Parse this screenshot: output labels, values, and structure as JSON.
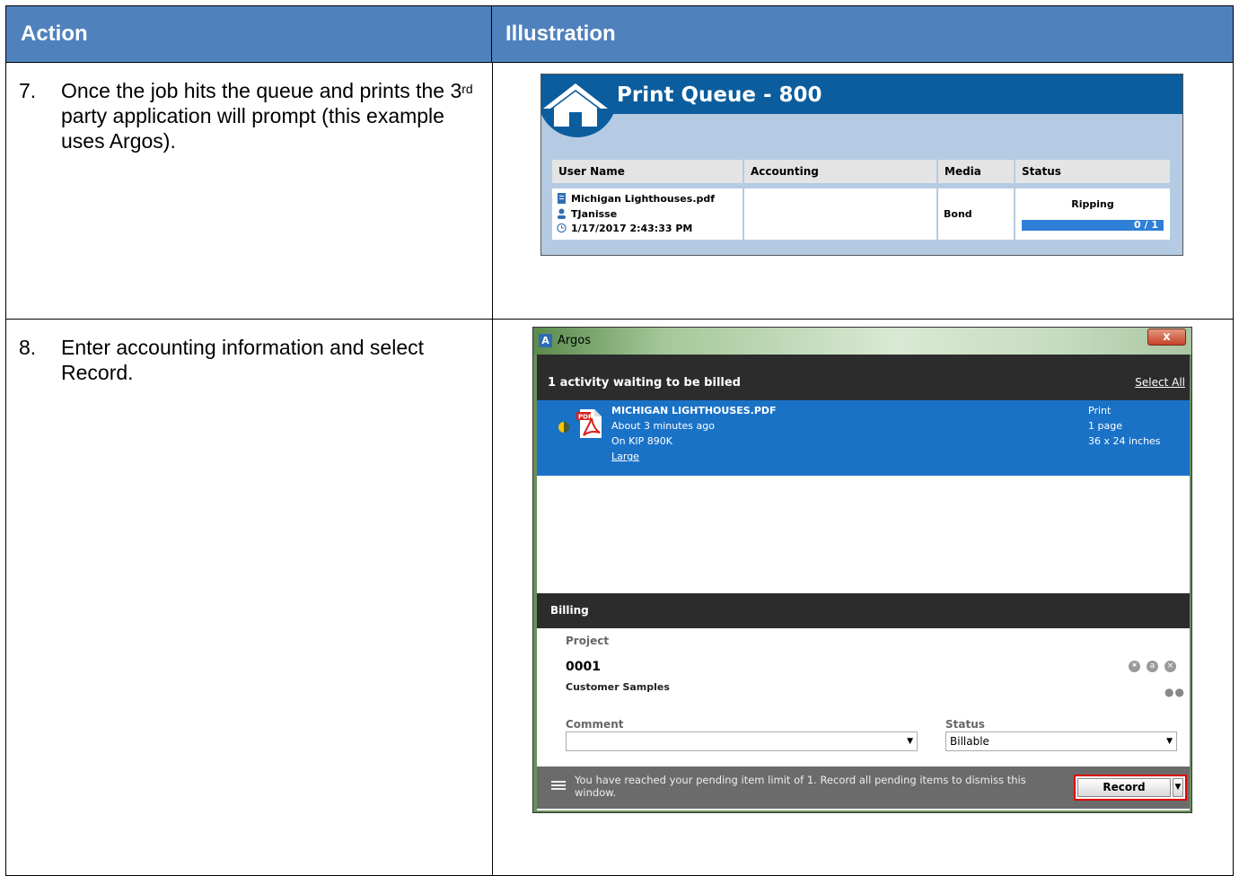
{
  "table": {
    "headers": {
      "action": "Action",
      "illustration": "Illustration"
    },
    "steps": [
      {
        "number": "7.",
        "text_a": "Once the job hits the queue and prints the 3",
        "sup": "rd",
        "text_b": " party application will prompt (this example uses Argos)."
      },
      {
        "number": "8.",
        "text": "Enter accounting information and select Record."
      }
    ]
  },
  "print_queue": {
    "title": "Print Queue - 800",
    "columns": [
      "User Name",
      "Accounting",
      "Media",
      "Status"
    ],
    "row": {
      "file": "Michigan Lighthouses.pdf",
      "user": "TJanisse",
      "time": "1/17/2017 2:43:33 PM",
      "accounting": "",
      "media": "Bond",
      "status": "Ripping",
      "progress_text": "0 / 1"
    }
  },
  "argos": {
    "window_title": "Argos",
    "close_label": "x",
    "activity_header": "1 activity waiting to be billed",
    "select_all": "Select All",
    "item": {
      "name": "MICHIGAN LIGHTHOUSES.PDF",
      "time": "About 3 minutes ago",
      "device": "On KIP 890K",
      "size_link": "Large",
      "type": "Print",
      "pages": "1 page",
      "dimensions": "36 x 24 inches"
    },
    "billing_header": "Billing",
    "project_label": "Project",
    "project_code": "0001",
    "project_desc": "Customer Samples",
    "comment_label": "Comment",
    "comment_value": "",
    "status_label": "Status",
    "status_value": "Billable",
    "footer_msg": "You have reached your pending item limit of 1. Record all pending items to dismiss this window.",
    "record_label": "Record",
    "highlight_color": "#e00000",
    "item_color": "#1a72c7"
  }
}
